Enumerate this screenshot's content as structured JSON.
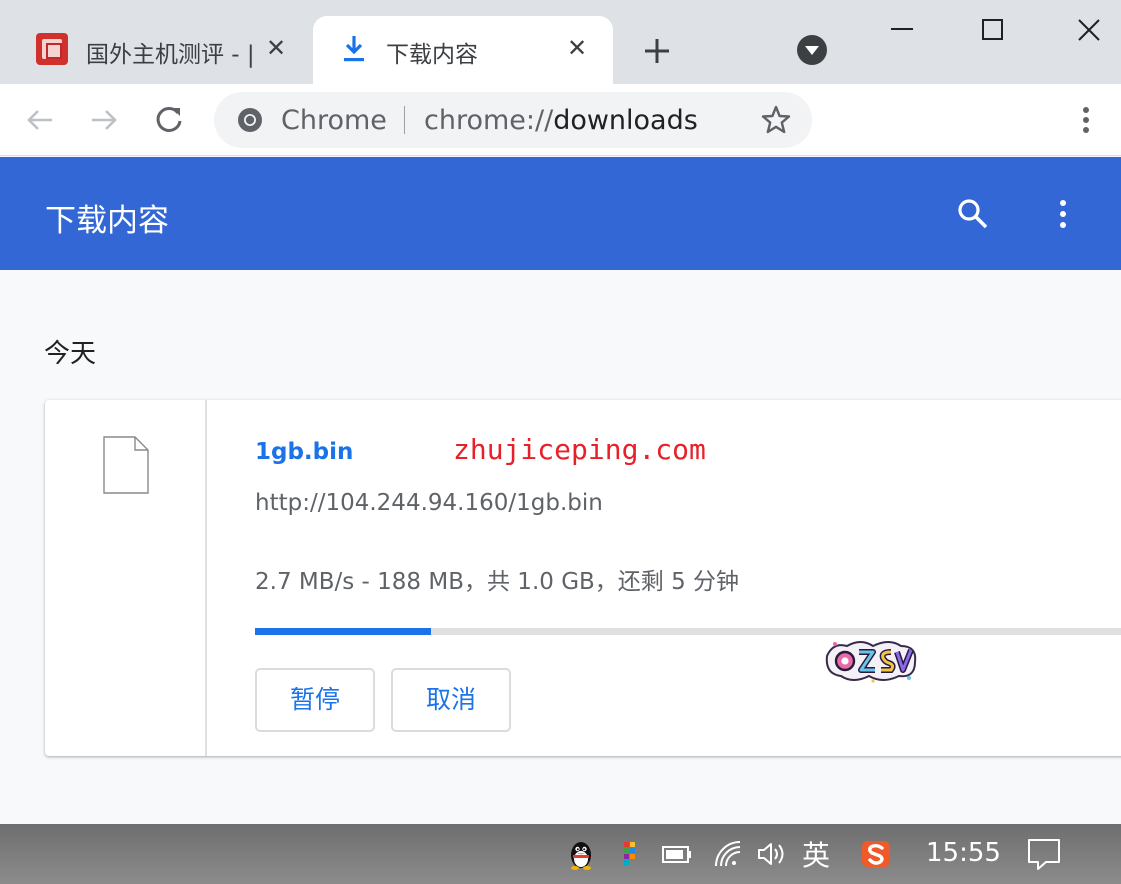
{
  "tabs": [
    {
      "title": "国外主机测评 - |",
      "close": "✕",
      "active": false
    },
    {
      "title": "下载内容",
      "close": "✕",
      "active": true
    }
  ],
  "omnibox": {
    "label": "Chrome",
    "url_scheme": "chrome://",
    "url_host": "downloads"
  },
  "page": {
    "title": "下载内容",
    "date_heading": "今天"
  },
  "download": {
    "file_name": "1gb.bin",
    "watermark": "zhujiceping.com",
    "url": "http://104.244.94.160/1gb.bin",
    "status": "2.7 MB/s - 188 MB，共 1.0 GB，还剩 5 分钟",
    "progress_fraction": 0.2,
    "pause_label": "暂停",
    "cancel_label": "取消",
    "logo_text": "OZSV"
  },
  "taskbar": {
    "lang": "英",
    "time": "15:55"
  },
  "colors": {
    "header_blue": "#3367d6",
    "link_blue": "#1a73e8",
    "watermark_red": "#e8202a"
  }
}
